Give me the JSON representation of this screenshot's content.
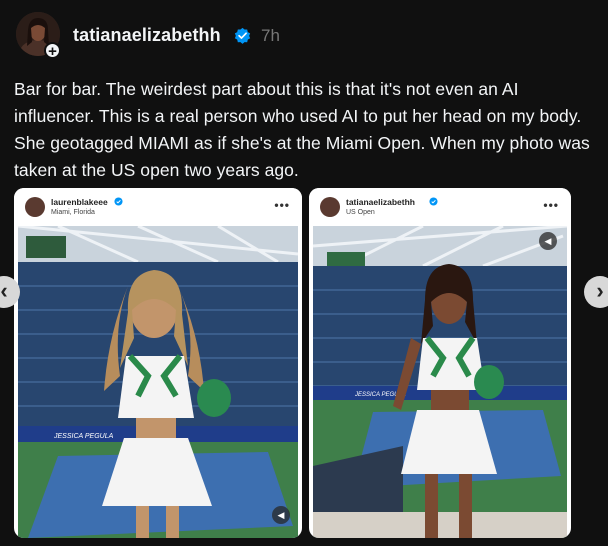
{
  "post": {
    "username": "tatianaelizabethh",
    "timestamp": "7h",
    "text": "Bar for bar. The weirdest part about this is that it's not even an AI influencer. This is a real person who used AI to put her head on my body. She geotagged MIAMI as if she's at the Miami Open. When my photo was taken at the US open two years ago."
  },
  "cards": [
    {
      "username": "laurenblakeee",
      "location": "Miami, Florida",
      "banner": "JESSICA PEGULA"
    },
    {
      "username": "tatianaelizabethh",
      "location": "US Open",
      "banner": "JESSICA PEGULA"
    }
  ],
  "icons": {
    "verified_color": "#0095f6",
    "prev": "chevron-left-icon",
    "next": "chevron-right-icon",
    "more": "more-dots-icon",
    "sound": "speaker-icon",
    "avatar_add": "plus-icon"
  },
  "ui": {
    "avatar_plus": "+",
    "more_dots": "•••",
    "prev_arrow": "‹",
    "next_arrow": "›",
    "sound_glyph": "◀"
  }
}
